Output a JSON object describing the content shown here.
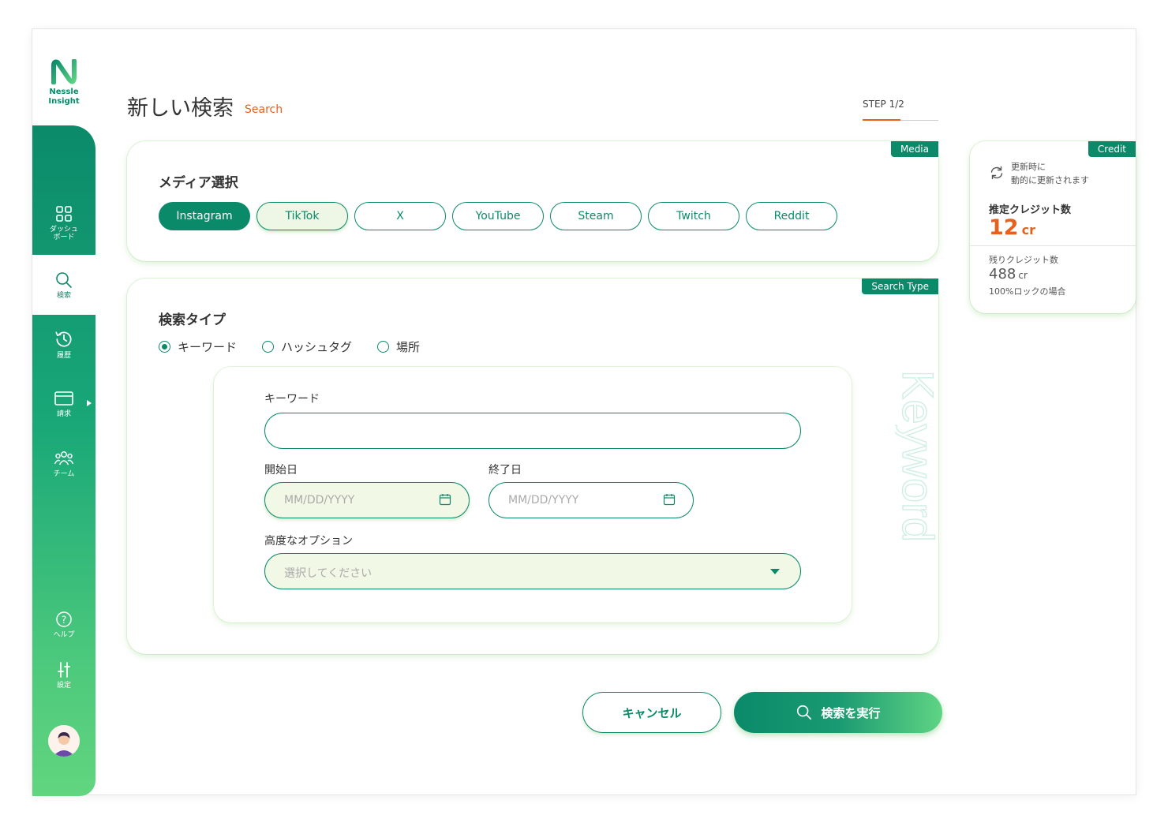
{
  "brand": {
    "line1": "Nessle",
    "line2": "Insight"
  },
  "nav": {
    "dashboard": "ダッシュボード",
    "search": "検索",
    "history": "履歴",
    "billing": "請求",
    "team": "チーム",
    "help": "ヘルプ",
    "settings": "設定"
  },
  "header": {
    "title": "新しい検索",
    "subtitle": "Search",
    "step": "STEP 1/2",
    "step_progress": 0.5
  },
  "media": {
    "tag": "Media",
    "title": "メディア選択",
    "chips": [
      "Instagram",
      "TikTok",
      "X",
      "YouTube",
      "Steam",
      "Twitch",
      "Reddit"
    ],
    "selected": "Instagram"
  },
  "search_type": {
    "tag": "Search Type",
    "title": "検索タイプ",
    "options": [
      "キーワード",
      "ハッシュタグ",
      "場所"
    ],
    "selected": "キーワード",
    "watermark": "Keyword"
  },
  "form": {
    "keyword_label": "キーワード",
    "keyword_value": "",
    "start_label": "開始日",
    "start_placeholder": "MM/DD/YYYY",
    "end_label": "終了日",
    "end_placeholder": "MM/DD/YYYY",
    "advanced_label": "高度なオプション",
    "advanced_placeholder": "選択してください"
  },
  "credit": {
    "tag": "Credit",
    "refresh_line1": "更新時に",
    "refresh_line2": "動的に更新されます",
    "estimate_label": "推定クレジット数",
    "estimate_value": "12",
    "estimate_unit": "cr",
    "remaining_label": "残りクレジット数",
    "remaining_value": "488",
    "remaining_unit": "cr",
    "remaining_note": "100%ロックの場合"
  },
  "actions": {
    "cancel": "キャンセル",
    "run": "検索を実行"
  },
  "colors": {
    "primary": "#0b8a6a",
    "accent": "#e8601c",
    "light": "#62d57f"
  }
}
